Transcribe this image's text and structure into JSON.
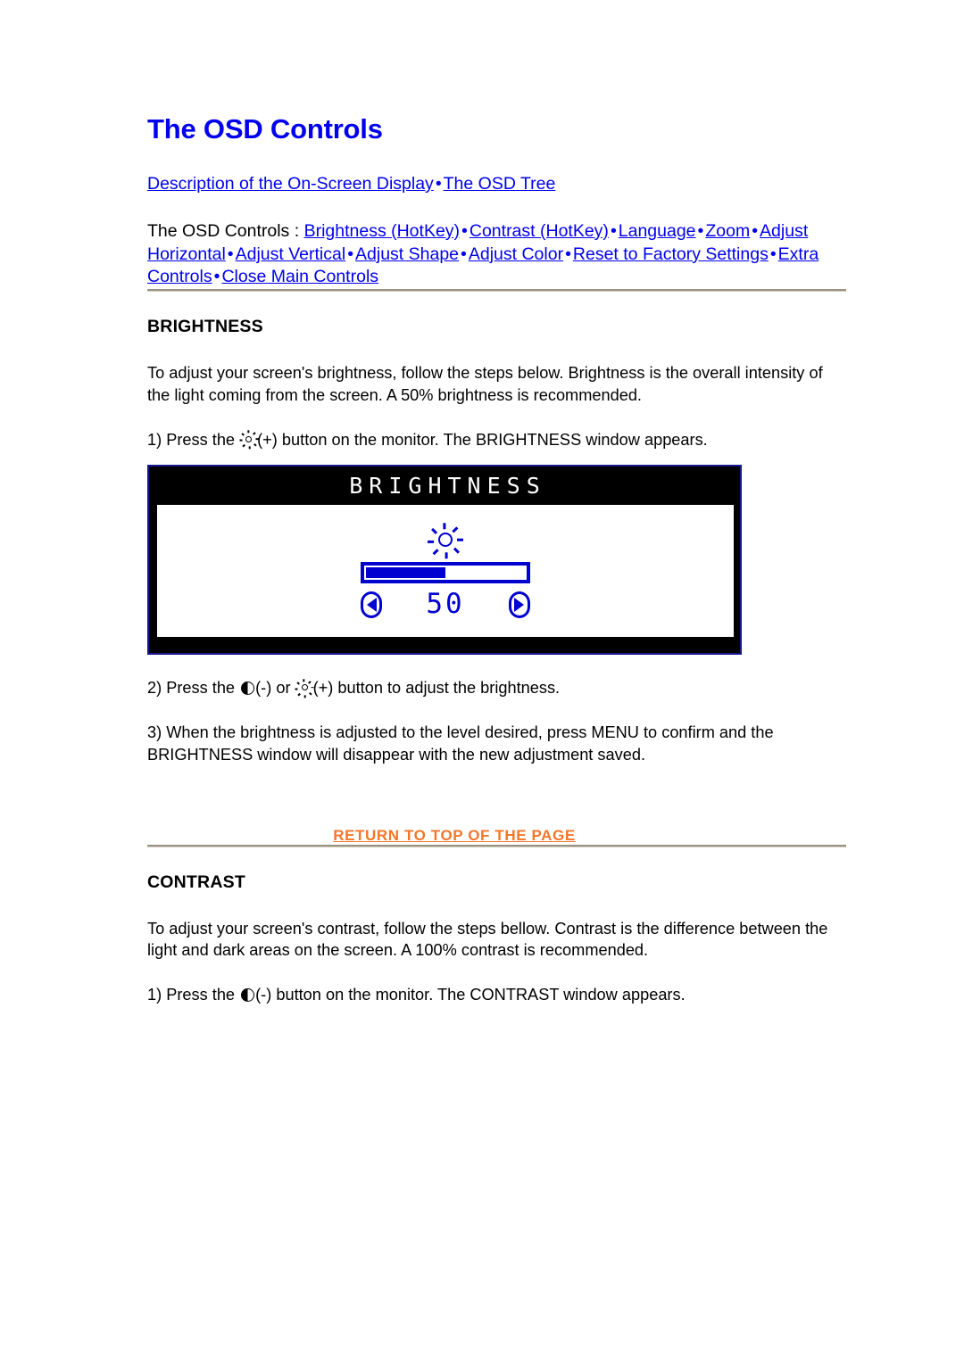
{
  "document": {
    "title": "The OSD Controls"
  },
  "nav": {
    "top_links": [
      {
        "label": "Description of the On-Screen Display"
      },
      {
        "label": "The OSD Tree"
      }
    ],
    "separator": "•",
    "controls_prefix": "The OSD Controls :",
    "control_links": [
      {
        "label": "Brightness (HotKey)"
      },
      {
        "label": "Contrast (HotKey)"
      },
      {
        "label": "Language"
      },
      {
        "label": "Zoom"
      },
      {
        "label": "Adjust Horizontal"
      },
      {
        "label": "Adjust Vertical"
      },
      {
        "label": "Adjust Shape"
      },
      {
        "label": "Adjust Color"
      },
      {
        "label": "Reset to Factory Settings"
      },
      {
        "label": "Extra Controls"
      },
      {
        "label": "Close Main Controls"
      }
    ]
  },
  "brightness_section": {
    "heading": "BRIGHTNESS",
    "intro": "To adjust your screen's brightness, follow the steps below. Brightness is the overall intensity of the light coming from the screen. A 50% brightness is recommended.",
    "step1_before": "1) Press the",
    "step1_icon": "sun-icon",
    "step1_after": "(+) button on the monitor. The BRIGHTNESS window appears.",
    "step2_before": "2) Press the",
    "step2_icon_a": "contrast-icon",
    "step2_middle": "(-) or",
    "step2_icon_b": "sun-icon",
    "step2_after": "(+) button to adjust the brightness.",
    "step3": "3) When the brightness is adjusted to the level desired, press MENU to confirm and the BRIGHTNESS window will disappear with the new adjustment saved."
  },
  "osd_window": {
    "title": "BRIGHTNESS",
    "icon": "sun-icon",
    "value": "50",
    "fill_percent": 50,
    "left_arrow": "left-arrow-icon",
    "right_arrow": "right-arrow-icon",
    "frame_color": "#17178f",
    "accent_color": "#0000d0"
  },
  "return_link": {
    "label": "RETURN TO TOP OF THE PAGE",
    "color": "#F4762A"
  },
  "contrast_section": {
    "heading": "CONTRAST",
    "intro": "To adjust your screen's contrast, follow the steps bellow. Contrast is the difference between the light and dark areas on the screen. A 100% contrast is recommended.",
    "step1_before": "1) Press the",
    "step1_icon": "contrast-icon",
    "step1_after": "(-) button on the monitor. The CONTRAST window appears."
  }
}
